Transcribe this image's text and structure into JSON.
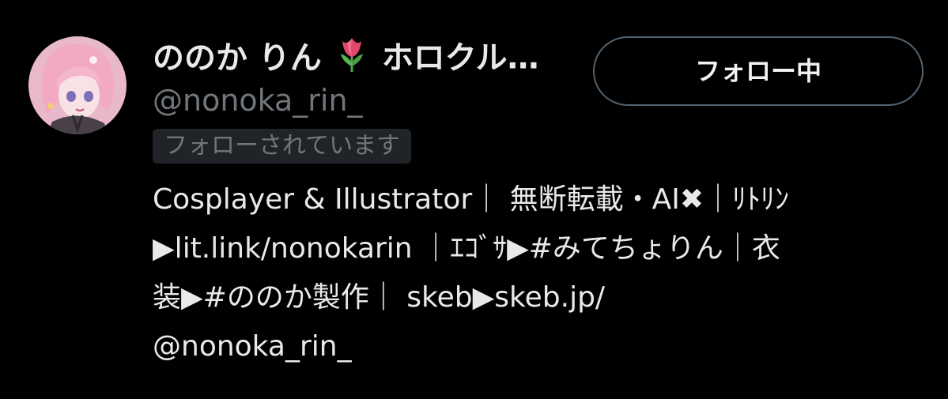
{
  "profile": {
    "display_name": "ののか りん",
    "display_name_suffix": "ホロクル…",
    "name_emoji": "tulip",
    "handle": "@nonoka_rin_",
    "follows_you": "フォローされています",
    "follow_button_label": "フォロー中",
    "bio_lines": [
      "Cosplayer & Illustrator｜ 無断転載・AI✖︎｜ﾘﾄﾘﾝ",
      "▶lit.link/nonokarin ｜ｴｺﾞｻ▶#みてちょりん｜衣",
      "装▶#ののか製作｜ skeb▶skeb.jp/",
      "@nonoka_rin_"
    ]
  },
  "colors": {
    "background": "#000000",
    "primary_text": "#e7e9ea",
    "secondary_text": "#71767b",
    "badge_bg": "#202327",
    "button_border": "#536471"
  },
  "icons": {
    "avatar": "profile-avatar-image",
    "name_emoji": "tulip-icon"
  }
}
